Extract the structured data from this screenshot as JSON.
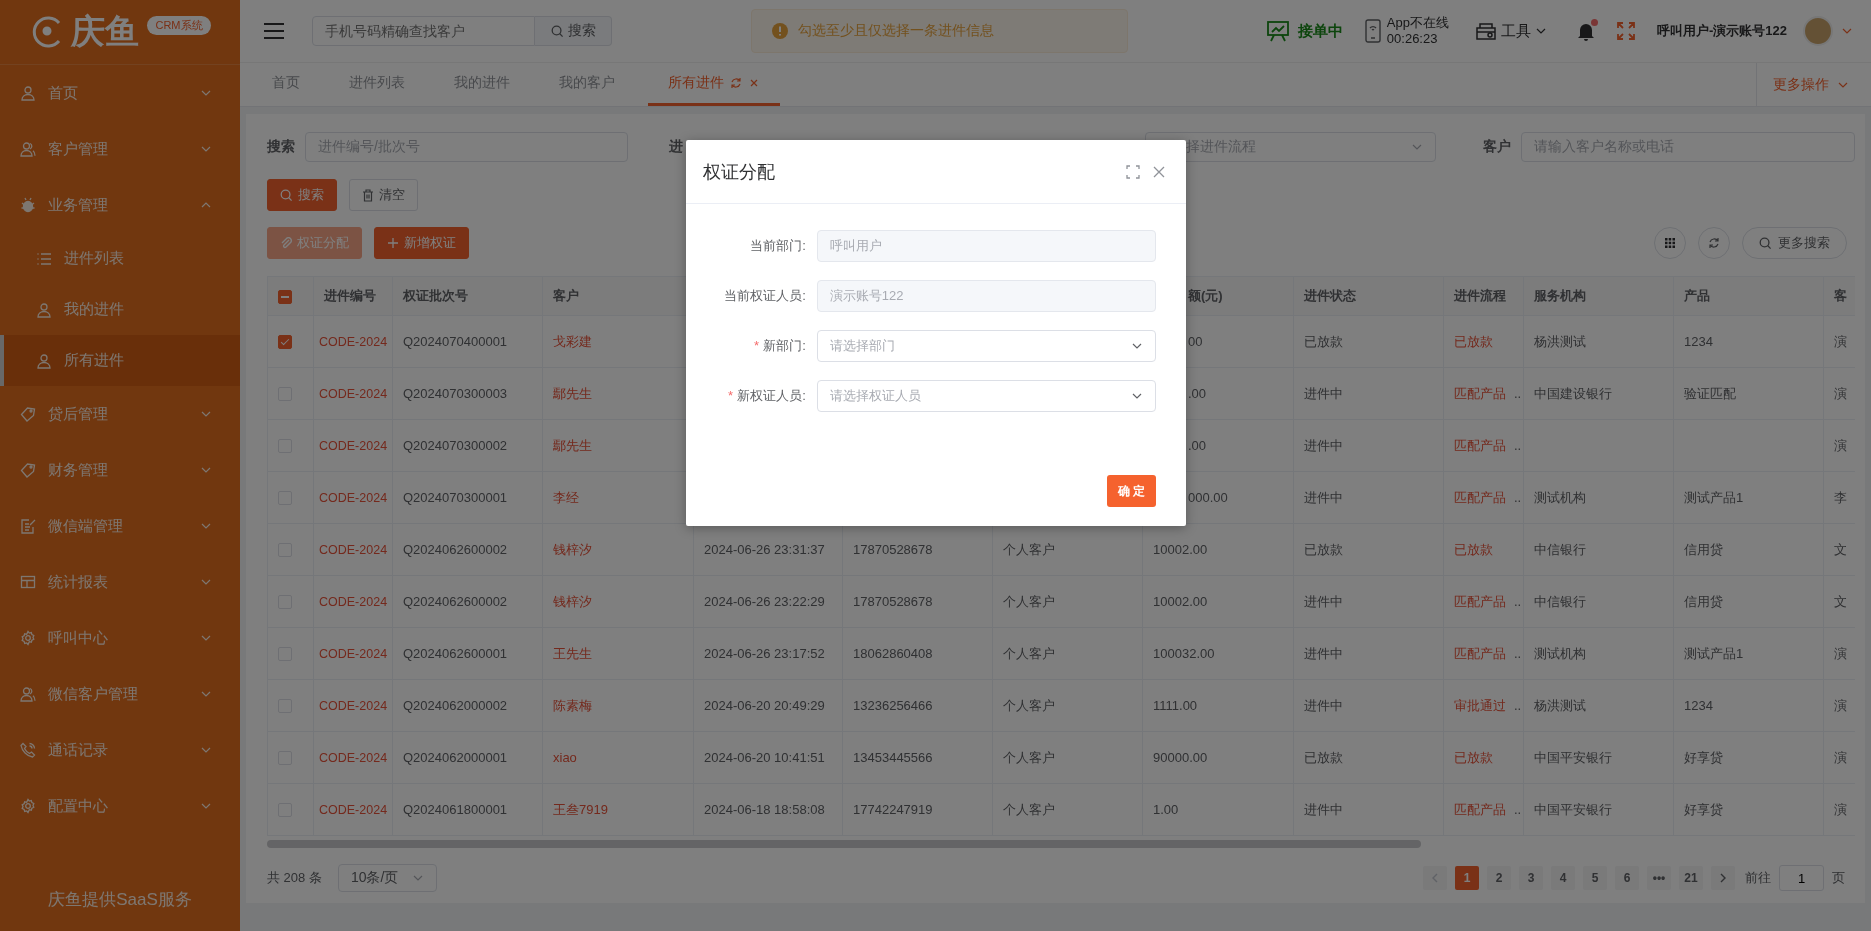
{
  "sidebar": {
    "logo": "庆鱼",
    "badge": "CRM系统",
    "items": [
      {
        "label": "首页",
        "expanded": false
      },
      {
        "label": "客户管理",
        "expanded": false
      },
      {
        "label": "业务管理",
        "expanded": true,
        "children": [
          {
            "label": "进件列表",
            "selected": false
          },
          {
            "label": "我的进件",
            "selected": false
          },
          {
            "label": "所有进件",
            "selected": true
          }
        ]
      },
      {
        "label": "贷后管理",
        "expanded": false
      },
      {
        "label": "财务管理",
        "expanded": false
      },
      {
        "label": "微信端管理",
        "expanded": false
      },
      {
        "label": "统计报表",
        "expanded": false
      },
      {
        "label": "呼叫中心",
        "expanded": false
      },
      {
        "label": "微信客户管理",
        "expanded": false
      },
      {
        "label": "通话记录",
        "expanded": false
      },
      {
        "label": "配置中心",
        "expanded": false
      }
    ],
    "footer": "庆鱼提供SaaS服务"
  },
  "topbar": {
    "search": {
      "placeholder": "手机号码精确查找客户",
      "button": "搜索"
    },
    "toast": "勾选至少且仅选择一条进件信息",
    "status": "接单中",
    "app_status": "App不在线",
    "app_timer": "00:26:23",
    "tools": "工具",
    "unread": true,
    "user": "呼叫用户-演示账号122"
  },
  "tabs": [
    {
      "label": "首页",
      "selected": false
    },
    {
      "label": "进件列表",
      "selected": false
    },
    {
      "label": "我的进件",
      "selected": false
    },
    {
      "label": "我的客户",
      "selected": false
    },
    {
      "label": "所有进件",
      "selected": true
    }
  ],
  "more_actions": "更多操作",
  "filters": {
    "search_label": "搜索",
    "search_placeholder": "进件编号/批次号",
    "label_2": "进",
    "select_placeholder": "择进件流程",
    "customer_label": "客户",
    "customer_placeholder": "请输入客户名称或电话"
  },
  "buttons": {
    "search": "搜索",
    "clear": "清空",
    "assign": "权证分配",
    "add": "新增权证",
    "more_search": "更多搜索"
  },
  "table": {
    "partially_checked": true,
    "columns": [
      {
        "label": "进件编号"
      },
      {
        "label": "权证批次号"
      },
      {
        "label": "客户"
      },
      {},
      {},
      {},
      {
        "label": "额(元)"
      },
      {
        "label": "进件状态"
      },
      {
        "label": "进件流程"
      },
      {
        "label": "服务机构"
      },
      {
        "label": "产品"
      },
      {
        "label": "客"
      }
    ],
    "rows": [
      {
        "checked": true,
        "code": "CODE-2024",
        "batch": "Q2024070400001",
        "customer": "戈彩建",
        "amount": "00",
        "status": "已放款",
        "flow": "已放款",
        "org": "杨洪测试",
        "product": "1234",
        "column_13": "演"
      },
      {
        "checked": false,
        "code": "CODE-2024",
        "batch": "Q2024070300003",
        "customer": "鄢先生",
        "amount": ".00",
        "status": "进件中",
        "flow": "匹配产品",
        "flow_more": "..",
        "org": "中国建设银行",
        "product": "验证匹配",
        "column_13": "演"
      },
      {
        "checked": false,
        "code": "CODE-2024",
        "batch": "Q2024070300002",
        "customer": "鄢先生",
        "amount": ".00",
        "status": "进件中",
        "flow": "匹配产品",
        "flow_more": "..",
        "column_13": "演"
      },
      {
        "checked": false,
        "code": "CODE-2024",
        "batch": "Q2024070300001",
        "customer": "李经",
        "amount": "000.00",
        "status": "进件中",
        "flow": "匹配产品",
        "flow_more": "..",
        "org": "测试机构",
        "product": "测试产品1",
        "column_13": "李"
      },
      {
        "checked": false,
        "code": "CODE-2024",
        "batch": "Q2024062600002",
        "customer": "钱梓汐",
        "column_5": "2024-06-26 23:31:37",
        "column_6": "17870528678",
        "column_7": "个人客户",
        "amount": "10002.00",
        "status": "已放款",
        "flow": "已放款",
        "org": "中信银行",
        "product": "信用贷",
        "column_13": "文"
      },
      {
        "checked": false,
        "code": "CODE-2024",
        "batch": "Q2024062600002",
        "customer": "钱梓汐",
        "column_5": "2024-06-26 23:22:29",
        "column_6": "17870528678",
        "column_7": "个人客户",
        "amount": "10002.00",
        "status": "进件中",
        "flow": "匹配产品",
        "flow_more": "..",
        "org": "中信银行",
        "product": "信用贷",
        "column_13": "文"
      },
      {
        "checked": false,
        "code": "CODE-2024",
        "batch": "Q2024062600001",
        "customer": "王先生",
        "column_5": "2024-06-26 23:17:52",
        "column_6": "18062860408",
        "column_7": "个人客户",
        "amount": "100032.00",
        "status": "进件中",
        "flow": "匹配产品",
        "flow_more": "..",
        "org": "测试机构",
        "product": "测试产品1",
        "column_13": "演"
      },
      {
        "checked": false,
        "code": "CODE-2024",
        "batch": "Q2024062000002",
        "customer": "陈素梅",
        "column_5": "2024-06-20 20:49:29",
        "column_6": "13236256466",
        "column_7": "个人客户",
        "amount": "1111.00",
        "status": "进件中",
        "flow": "审批通过",
        "flow_more": "..",
        "org": "杨洪测试",
        "product": "1234",
        "column_13": "演"
      },
      {
        "checked": false,
        "code": "CODE-2024",
        "batch": "Q2024062000001",
        "customer": "xiao",
        "column_5": "2024-06-20 10:41:51",
        "column_6": "13453445566",
        "column_7": "个人客户",
        "amount": "90000.00",
        "status": "已放款",
        "flow": "已放款",
        "org": "中国平安银行",
        "product": "好享贷",
        "column_13": "演"
      },
      {
        "checked": false,
        "code": "CODE-2024",
        "batch": "Q2024061800001",
        "customer": "王叁7919",
        "column_5": "2024-06-18 18:58:08",
        "column_6": "17742247919",
        "column_7": "个人客户",
        "amount": "1.00",
        "status": "进件中",
        "flow": "匹配产品",
        "flow_more": "..",
        "org": "中国平安银行",
        "product": "好享贷",
        "column_13": "演"
      }
    ]
  },
  "pagination": {
    "total": "共 208 条",
    "page_size": "10条/页",
    "pages": [
      {
        "label": "1",
        "selected": true
      },
      {
        "label": "2",
        "selected": false
      },
      {
        "label": "3",
        "selected": false
      },
      {
        "label": "4",
        "selected": false
      },
      {
        "label": "5",
        "selected": false
      },
      {
        "label": "6",
        "selected": false
      },
      {
        "label": "•••",
        "selected": false
      },
      {
        "label": "21",
        "selected": false
      }
    ],
    "goto_label": "前往",
    "goto_value": "1",
    "goto_suffix": "页"
  },
  "dialog": {
    "title": "权证分配",
    "fields": [
      {
        "label": "当前部门:",
        "kind": "input",
        "value": "呼叫用户",
        "disabled": true
      },
      {
        "label": "当前权证人员:",
        "kind": "input",
        "value": "演示账号122",
        "disabled": true
      },
      {
        "required_mark": "*",
        "label": "新部门:",
        "kind": "select",
        "placeholder": "请选择部门",
        "disabled": false
      },
      {
        "required_mark": "*",
        "label": "新权证人员:",
        "kind": "select",
        "placeholder": "请选择权证人员",
        "disabled": false
      }
    ],
    "confirm": "确 定"
  }
}
